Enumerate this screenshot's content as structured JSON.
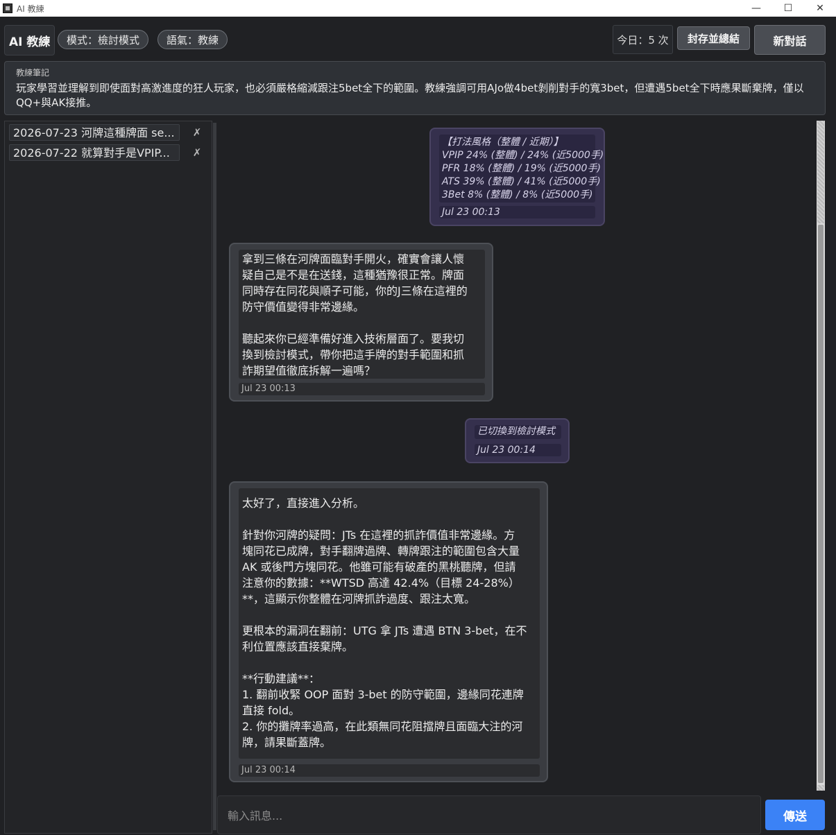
{
  "window": {
    "title": "AI 教練",
    "minimize": "—",
    "maximize": "☐",
    "close": "✕"
  },
  "header": {
    "app_title": "AI 教練",
    "mode_pill": "模式：檢討模式",
    "tone_pill": "語氣：教練",
    "today_count": "今日：5 次",
    "archive_button": "封存並總結",
    "new_chat_button": "新對話"
  },
  "note": {
    "label": "教練筆記",
    "text": "玩家學習並理解到即使面對高激進度的狂人玩家，也必須嚴格縮減跟注5bet全下的範圍。教練強調可用AJo做4bet剝削對手的寬3bet，但遭遇5bet全下時應果斷棄牌，僅以QQ+與AK接推。"
  },
  "sidebar": {
    "items": [
      {
        "label": "2026-07-23  河牌這種牌面 se...",
        "delete": "✗"
      },
      {
        "label": "2026-07-22  就算對手是VPIP...",
        "delete": "✗"
      }
    ]
  },
  "messages": {
    "m1": {
      "lines": [
        "【打法風格（整體 / 近期）】",
        "VPIP 24% (整體) / 24% (近5000手)",
        "PFR 18% (整體) / 19% (近5000手)",
        "ATS 39% (整體) / 41% (近5000手)",
        "3Bet 8% (整體) / 8% (近5000手)"
      ],
      "time": "Jul 23 00:13"
    },
    "m2": {
      "lines": [
        "拿到三條在河牌面臨對手開火，確實會讓人懷",
        "疑自己是不是在送錢，這種猶豫很正常。牌面",
        "同時存在同花與順子可能，你的J三條在這裡的",
        "防守價值變得非常邊緣。",
        "",
        "聽起來你已經準備好進入技術層面了。要我切",
        "換到檢討模式，帶你把這手牌的對手範圍和抓",
        "詐期望值徹底拆解一遍嗎？"
      ],
      "time": "Jul 23 00:13"
    },
    "m3": {
      "lines": [
        "已切換到檢討模式"
      ],
      "time": "Jul 23 00:14"
    },
    "m4": {
      "lines": [
        "太好了，直接進入分析。",
        "",
        "針對你河牌的疑問：JTs 在這裡的抓詐價值非常邊緣。方",
        "塊同花已成牌，對手翻牌過牌、轉牌跟注的範圍包含大量",
        "AK 或後門方塊同花。他雖可能有破產的黑桃聽牌，但請",
        "注意你的數據：**WTSD 高達 42.4%（目標 24-28%）",
        "**，這顯示你整體在河牌抓詐過度、跟注太寬。",
        "",
        "更根本的漏洞在翻前：UTG 拿 JTs 遭遇 BTN 3-bet，在不",
        "利位置應該直接棄牌。",
        "",
        "**行動建議**：",
        "1. 翻前收緊 OOP 面對 3-bet 的防守範圍，邊緣同花連牌",
        "直接 fold。",
        "2. 你的攤牌率過高，在此類無同花阻擋牌且面臨大注的河",
        "牌，請果斷蓋牌。"
      ],
      "time": "Jul 23 00:14"
    }
  },
  "input": {
    "placeholder": "輸入訊息...",
    "send_button": "傳送"
  }
}
